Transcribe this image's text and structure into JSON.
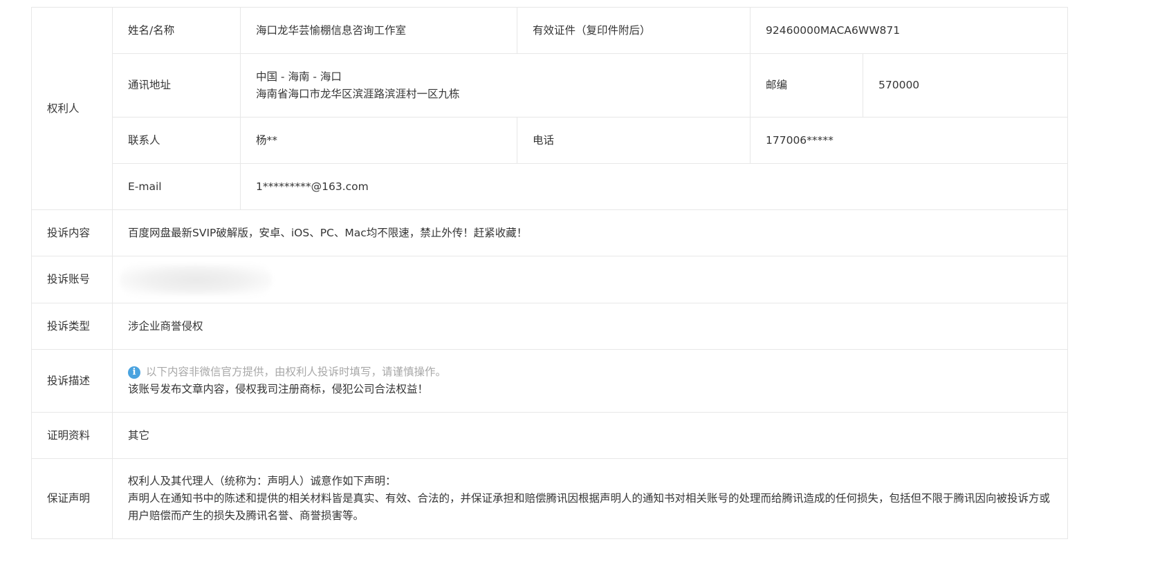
{
  "rights_holder": {
    "section_label": "权利人",
    "name_label": "姓名/名称",
    "name_value": "海口龙华芸愉棚信息咨询工作室",
    "id_label": "有效证件（复印件附后）",
    "id_value": "92460000MACA6WW871",
    "address_label": "通讯地址",
    "address_line1": "中国 - 海南 - 海口",
    "address_line2": "海南省海口市龙华区滨涯路滨涯村一区九栋",
    "postcode_label": "邮编",
    "postcode_value": "570000",
    "contact_label": "联系人",
    "contact_value": "杨**",
    "phone_label": "电话",
    "phone_value": "177006*****",
    "email_label": "E-mail",
    "email_value": "1*********@163.com"
  },
  "complaint_content": {
    "label": "投诉内容",
    "value": "百度网盘最新SVIP破解版，安卓、iOS、PC、Mac均不限速，禁止外传！赶紧收藏！"
  },
  "complaint_account": {
    "label": "投诉账号"
  },
  "complaint_type": {
    "label": "投诉类型",
    "value": "涉企业商誉侵权"
  },
  "complaint_description": {
    "label": "投诉描述",
    "notice_icon": "info-icon",
    "notice": "以下内容非微信官方提供，由权利人投诉时填写，请谨慎操作。",
    "value": "该账号发布文章内容，侵权我司注册商标，侵犯公司合法权益！"
  },
  "evidence": {
    "label": "证明资料",
    "value": "其它"
  },
  "guarantee": {
    "label": "保证声明",
    "line1": "权利人及其代理人（统称为：声明人）诚意作如下声明：",
    "line2": "声明人在通知书中的陈述和提供的相关材料皆是真实、有效、合法的，并保证承担和赔偿腾讯因根据声明人的通知书对相关账号的处理而给腾讯造成的任何损失，包括但不限于腾讯因向被投诉方或用户赔偿而产生的损失及腾讯名誉、商誉损害等。"
  },
  "colors": {
    "border": "#e7e7e7",
    "text": "#353535",
    "notice_text": "#a8a8a8",
    "info_icon": "#4aa3df"
  }
}
